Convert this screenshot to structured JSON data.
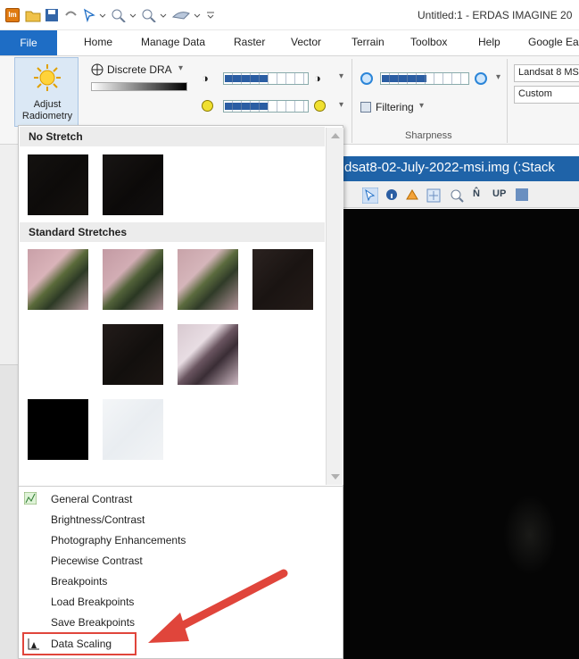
{
  "window": {
    "title": "Untitled:1 - ERDAS IMAGINE 20"
  },
  "ribbon_tabs": {
    "file": "File",
    "items": [
      "Home",
      "Manage Data",
      "Raster",
      "Vector",
      "Terrain",
      "Toolbox",
      "Help",
      "Google Ear"
    ]
  },
  "ribbon": {
    "adjust_radiometry_label": "Adjust\nRadiometry",
    "discrete_dra": "Discrete DRA",
    "filtering": "Filtering",
    "sharpness": "Sharpness",
    "sensor_preset": "Landsat 8 MS",
    "custom_preset": "Custom"
  },
  "viewer": {
    "title": "dsat8-02-July-2022-msi.img (:Stack"
  },
  "dropdown": {
    "sections": [
      {
        "header": "No Stretch"
      },
      {
        "header": "Standard Stretches"
      }
    ],
    "menu_items": [
      "General Contrast",
      "Brightness/Contrast",
      "Photography Enhancements",
      "Piecewise Contrast",
      "Breakpoints",
      "Load Breakpoints",
      "Save Breakpoints",
      "Data Scaling"
    ]
  },
  "colors": {
    "accent": "#1e6dc5",
    "highlight": "#e0453b",
    "viewer_title_bg": "#1f63a8"
  }
}
